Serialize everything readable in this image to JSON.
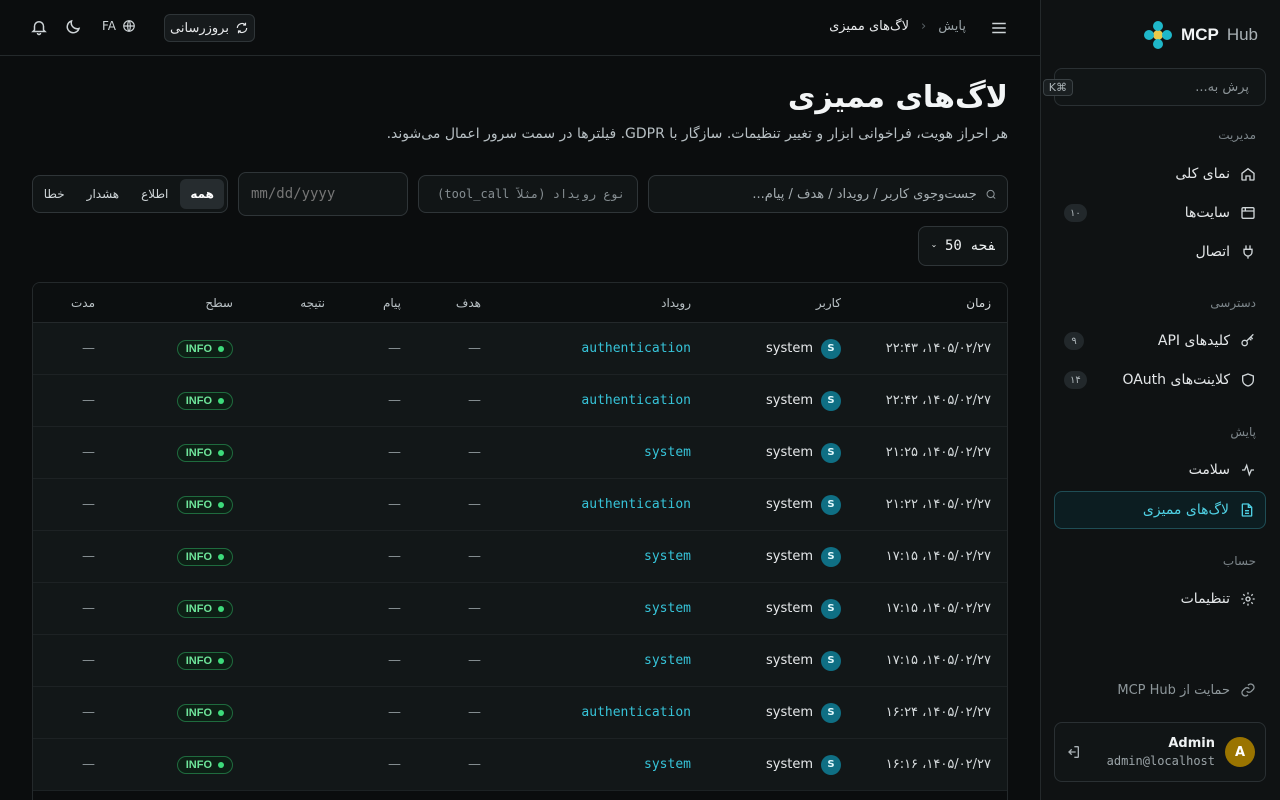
{
  "app": {
    "brand_bold": "MCP",
    "brand_light": "Hub"
  },
  "sidebar": {
    "search_placeholder": "پرش به...",
    "search_shortcut": "⌘K",
    "groups": [
      {
        "title": "مدیریت",
        "items": [
          {
            "label": "نمای کلی",
            "icon": "home-icon",
            "badge": ""
          },
          {
            "label": "سایت‌ها",
            "icon": "browser-window-icon",
            "badge": "۱۰"
          },
          {
            "label": "اتصال",
            "icon": "plug-icon",
            "badge": ""
          }
        ]
      },
      {
        "title": "دسترسی",
        "items": [
          {
            "label": "کلیدهای API",
            "icon": "key-icon",
            "badge": "۹"
          },
          {
            "label": "کلاینت‌های OAuth",
            "icon": "shield-icon",
            "badge": "۱۴"
          }
        ]
      },
      {
        "title": "پایش",
        "items": [
          {
            "label": "سلامت",
            "icon": "pulse-icon",
            "badge": ""
          },
          {
            "label": "لاگ‌های ممیزی",
            "icon": "file-text-icon",
            "badge": "",
            "active": true
          }
        ]
      },
      {
        "title": "حساب",
        "items": [
          {
            "label": "تنظیمات",
            "icon": "gear-icon",
            "badge": ""
          }
        ]
      }
    ],
    "support_label": "حمایت از MCP Hub",
    "user": {
      "initial": "A",
      "name": "Admin",
      "email": "admin@localhost"
    }
  },
  "topbar": {
    "breadcrumb_parent": "پایش",
    "breadcrumb_current": "لاگ‌های ممیزی",
    "refresh_label": "بروزرسانی",
    "lang_label": "FA"
  },
  "page": {
    "title": "لاگ‌های ممیزی",
    "description": "هر احراز هویت، فراخوانی ابزار و تغییر تنظیمات. سازگار با GDPR. فیلترها در سمت سرور اعمال می‌شوند."
  },
  "filters": {
    "search_placeholder": "جست‌وجوی کاربر / رویداد / هدف / پیام...",
    "event_placeholder": "نوع رویداد (مثلاً tool_call)",
    "date_placeholder": "mm/dd/yyyy",
    "levels": [
      "همه",
      "اطلاع",
      "هشدار",
      "خطا"
    ],
    "active_level": "همه",
    "per_page": "50 در صفحه"
  },
  "table": {
    "headers": {
      "time": "زمان",
      "user": "کاربر",
      "event": "رویداد",
      "target": "هدف",
      "message": "پیام",
      "result": "نتیجه",
      "level": "سطح",
      "duration": "مدت"
    },
    "rows": [
      {
        "time": "۱۴۰۵/۰۲/۲۷، ۲۲:۴۳",
        "user_initial": "S",
        "user": "system",
        "event": "authentication",
        "target": "—",
        "message": "—",
        "result": "",
        "level": "INFO",
        "duration": "—"
      },
      {
        "time": "۱۴۰۵/۰۲/۲۷، ۲۲:۴۲",
        "user_initial": "S",
        "user": "system",
        "event": "authentication",
        "target": "—",
        "message": "—",
        "result": "",
        "level": "INFO",
        "duration": "—"
      },
      {
        "time": "۱۴۰۵/۰۲/۲۷، ۲۱:۲۵",
        "user_initial": "S",
        "user": "system",
        "event": "system",
        "target": "—",
        "message": "—",
        "result": "",
        "level": "INFO",
        "duration": "—"
      },
      {
        "time": "۱۴۰۵/۰۲/۲۷، ۲۱:۲۲",
        "user_initial": "S",
        "user": "system",
        "event": "authentication",
        "target": "—",
        "message": "—",
        "result": "",
        "level": "INFO",
        "duration": "—"
      },
      {
        "time": "۱۴۰۵/۰۲/۲۷، ۱۷:۱۵",
        "user_initial": "S",
        "user": "system",
        "event": "system",
        "target": "—",
        "message": "—",
        "result": "",
        "level": "INFO",
        "duration": "—"
      },
      {
        "time": "۱۴۰۵/۰۲/۲۷، ۱۷:۱۵",
        "user_initial": "S",
        "user": "system",
        "event": "system",
        "target": "—",
        "message": "—",
        "result": "",
        "level": "INFO",
        "duration": "—"
      },
      {
        "time": "۱۴۰۵/۰۲/۲۷، ۱۷:۱۵",
        "user_initial": "S",
        "user": "system",
        "event": "system",
        "target": "—",
        "message": "—",
        "result": "",
        "level": "INFO",
        "duration": "—"
      },
      {
        "time": "۱۴۰۵/۰۲/۲۷، ۱۶:۲۴",
        "user_initial": "S",
        "user": "system",
        "event": "authentication",
        "target": "—",
        "message": "—",
        "result": "",
        "level": "INFO",
        "duration": "—"
      },
      {
        "time": "۱۴۰۵/۰۲/۲۷، ۱۶:۱۶",
        "user_initial": "S",
        "user": "system",
        "event": "system",
        "target": "—",
        "message": "—",
        "result": "",
        "level": "INFO",
        "duration": "—"
      }
    ]
  },
  "colors": {
    "accent": "#36c3d8",
    "info": "#6ee59a",
    "brand_icon": "#1fb7c9"
  }
}
